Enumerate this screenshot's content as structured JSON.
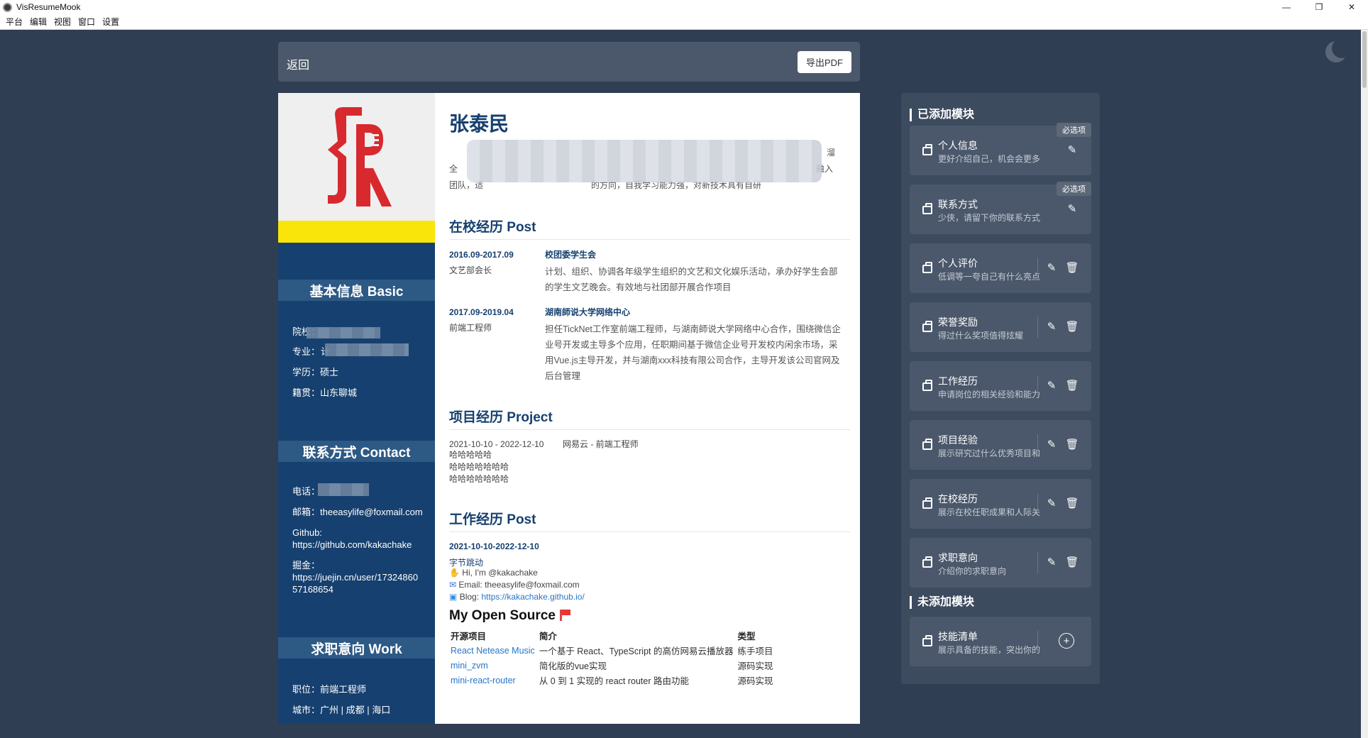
{
  "window": {
    "title": "VisResumeMook",
    "controls": [
      "—",
      "❐",
      "✕"
    ]
  },
  "menu": [
    "平台",
    "编辑",
    "视图",
    "窗口",
    "设置"
  ],
  "topbar": {
    "back": "返回",
    "export": "导出PDF"
  },
  "resume": {
    "name": "张泰民",
    "intro": {
      "l1_end": "溜",
      "l2_start": "全",
      "l2_end": "融入",
      "l3_start": "团队，适",
      "l3_mid": "的方向，自我学习能力强，对新技术具有自研"
    },
    "basic": {
      "title": "基本信息 Basic",
      "school_label": "院校：",
      "major_label": "专业：",
      "major_value": "计",
      "degree": "学历：硕士",
      "hometown": "籍贯：山东聊城"
    },
    "contact": {
      "title": "联系方式 Contact",
      "phone_label": "电话：",
      "email": "邮箱：theeasylife@foxmail.com",
      "github_label": "Github:",
      "github_url": "https://github.com/kakachake",
      "juejin_label": "掘金：",
      "juejin_url_1": "https://juejin.cn/user/17324860",
      "juejin_url_2": "57168654"
    },
    "work_intent": {
      "title": "求职意向 Work",
      "position": "职位：前端工程师",
      "city": "城市：广州 | 成都 | 海口"
    },
    "campus": {
      "title": "在校经历 Post",
      "items": [
        {
          "date": "2016.09-2017.09",
          "role": "文艺部会长",
          "org": "校团委学生会",
          "desc": "计划、组织、协调各年级学生组织的文艺和文化娱乐活动，承办好学生会部的学生文艺晚会。有效地与社团部开展合作项目"
        },
        {
          "date": "2017.09-2019.04",
          "role": "前端工程师",
          "org": "湖南師说大学网络中心",
          "desc": "担任TickNet工作室前端工程师，与湖南師说大学网络中心合作，围绕微信企业号开发或主导多个应用，任职期间基于微信企业号开发校内闲余市场，采用Vue.js主导开发，并与湖南xxx科技有限公司合作，主导开发该公司官网及后台管理"
        }
      ]
    },
    "project": {
      "title": "项目经历 Project",
      "date": "2021-10-10 - 2022-12-10",
      "company": "网易云 - 前端工程师",
      "lines": [
        "哈哈哈哈哈",
        "哈哈哈哈哈哈哈",
        "哈哈哈哈哈哈哈"
      ]
    },
    "work": {
      "title": "工作经历 Post",
      "date": "2021-10-10-2022-12-10",
      "company": "字节跳动",
      "hi": "Hi, I'm @kakachake",
      "email": "Email: theeasylife@foxmail.com",
      "blog_label": "Blog: ",
      "blog_url": "https://kakachake.github.io/",
      "os_title": "My Open Source",
      "table_headers": [
        "开源项目",
        "简介",
        "类型"
      ],
      "table_rows": [
        [
          "React Netease Music",
          "一个基于 React、TypeScript 的高仿网易云播放器",
          "练手项目"
        ],
        [
          "mini_zvm",
          "简化版的vue实现",
          "源码实现"
        ],
        [
          "mini-react-router",
          "从 0 到 1 实现的 react router 路由功能",
          "源码实现"
        ]
      ]
    }
  },
  "panel": {
    "added_title": "已添加模块",
    "not_added_title": "未添加模块",
    "required_badge": "必选项",
    "modules": [
      {
        "name": "个人信息",
        "desc": "更好介绍自己，机会会更多"
      },
      {
        "name": "联系方式",
        "desc": "少侠，请留下你的联系方式"
      },
      {
        "name": "个人评价",
        "desc": "低调等一夸自己有什么亮点"
      },
      {
        "name": "荣誉奖励",
        "desc": "得过什么奖项值得炫耀"
      },
      {
        "name": "工作经历",
        "desc": "申请岗位的相关经验和能力"
      },
      {
        "name": "项目经验",
        "desc": "展示研究过什么优秀项目和"
      },
      {
        "name": "在校经历",
        "desc": "展示在校任职成果和人际关"
      },
      {
        "name": "求职意向",
        "desc": "介绍你的求职意向"
      }
    ],
    "unadded": [
      {
        "name": "技能清单",
        "desc": "展示具备的技能，突出你的能力"
      }
    ]
  },
  "colors": {
    "background": "#2f3e52",
    "resume_sidebar": "#16406f",
    "accent_yellow": "#f9e50a",
    "logo_red": "#d8292f"
  }
}
